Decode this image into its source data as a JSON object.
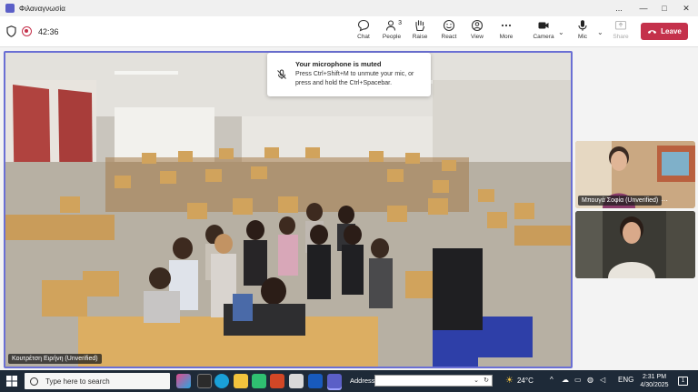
{
  "window": {
    "title": "Φιλαναγνωσία",
    "controls": [
      "...",
      "—",
      "□",
      "✕"
    ]
  },
  "toolbar": {
    "timer": "42:36",
    "buttons": [
      {
        "label": "Chat",
        "icon": "chat-icon"
      },
      {
        "label": "People",
        "icon": "people-icon",
        "badge": "3"
      },
      {
        "label": "Raise",
        "icon": "raise-hand-icon"
      },
      {
        "label": "React",
        "icon": "react-icon"
      },
      {
        "label": "View",
        "icon": "view-icon"
      },
      {
        "label": "More",
        "icon": "more-icon"
      },
      {
        "label": "Camera",
        "icon": "camera-icon"
      },
      {
        "label": "Mic",
        "icon": "mic-icon"
      },
      {
        "label": "Share",
        "icon": "share-icon",
        "disabled": true
      }
    ],
    "leave_label": "Leave",
    "accent": "#c4314b"
  },
  "toast": {
    "title": "Your microphone is muted",
    "body": "Press Ctrl+Shift+M to unmute your mic, or press and hold the Ctrl+Spacebar."
  },
  "participants": {
    "main": {
      "name": "Κουτρέτση Ειρήνη (Unverified)"
    },
    "tiles": [
      {
        "name": "Μπουγά Σοφία (Unverified)",
        "more": "···"
      },
      {
        "name": ""
      }
    ]
  },
  "taskbar": {
    "search_placeholder": "Type here to search",
    "address_label": "Address",
    "address_value": "",
    "weather": "24°C",
    "language": "ENG",
    "time": "2:31 PM",
    "date": "4/30/2025",
    "notification_count": "1"
  }
}
